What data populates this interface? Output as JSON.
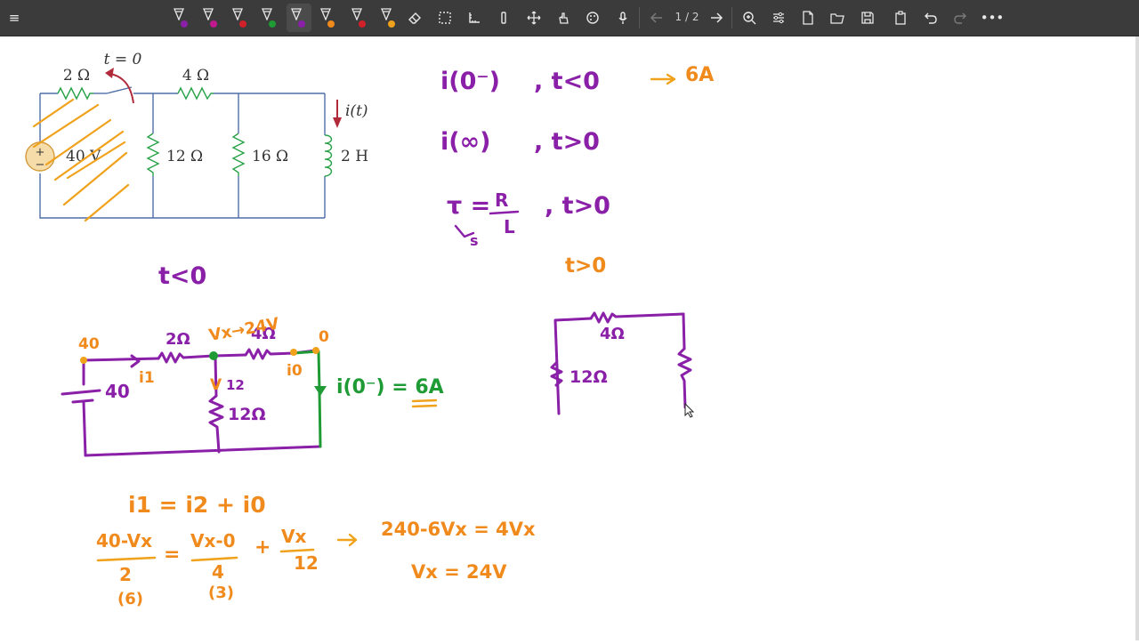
{
  "toolbar": {
    "pens": [
      {
        "name": "pen-tool-purple",
        "color": "#8a1fa8"
      },
      {
        "name": "pen-tool-magenta",
        "color": "#c2188f"
      },
      {
        "name": "pen-tool-red",
        "color": "#d0202a"
      },
      {
        "name": "pen-tool-green",
        "color": "#1f9b35"
      },
      {
        "name": "pen-tool-purple-active",
        "color": "#8a1fa8"
      },
      {
        "name": "pen-tool-orange",
        "color": "#f08a1c"
      },
      {
        "name": "pen-tool-red-2",
        "color": "#d0202a"
      },
      {
        "name": "pen-tool-orange-2",
        "color": "#f0a21c"
      }
    ],
    "page_indicator": "1 / 2"
  },
  "textbook_circuit": {
    "switch_label": "t = 0",
    "r_source": "2 Ω",
    "r_series": "4 Ω",
    "source": "40 V",
    "source_plus": "+",
    "source_minus": "−",
    "r_12": "12 Ω",
    "r_16": "16 Ω",
    "inductor": "2 H",
    "current": "i(t)"
  },
  "notes_right": {
    "line1_left": "i(0⁻)",
    "line1_cond": ", t<0",
    "line1_result": "6A",
    "line2_left": "i(∞)",
    "line2_cond": ", t>0",
    "tau_lhs": "τ =",
    "tau_num": "R",
    "tau_den": "L",
    "tau_sub": "s",
    "tau_cond": ", t>0",
    "orange_cond": "t>0"
  },
  "notes_left": {
    "heading": "t<0",
    "node_left": "40",
    "node_right": "0",
    "source_label": "40",
    "r_2": "2Ω",
    "r_4": "4Ω",
    "vx_value": "Vx→24V",
    "v_12": "V",
    "r_12": "12Ω",
    "i1": "i1",
    "i0": "i0",
    "result": "i(0⁻) = 6A"
  },
  "notes_mid": {
    "r_4": "4Ω",
    "r_12": "12Ω"
  },
  "equations": {
    "kcl": "i1 =  i2 + i0",
    "frac1_num": "40-Vx",
    "frac1_den": "2",
    "frac1_mult": "(6)",
    "eq": "=",
    "frac2_num": "Vx-0",
    "frac2_den": "4",
    "frac2_mult": "(3)",
    "plus": "+",
    "frac3_num": "Vx",
    "frac3_den": "12",
    "arrow_eq": "240-6Vx = 4Vx",
    "result": "Vx = 24V"
  }
}
